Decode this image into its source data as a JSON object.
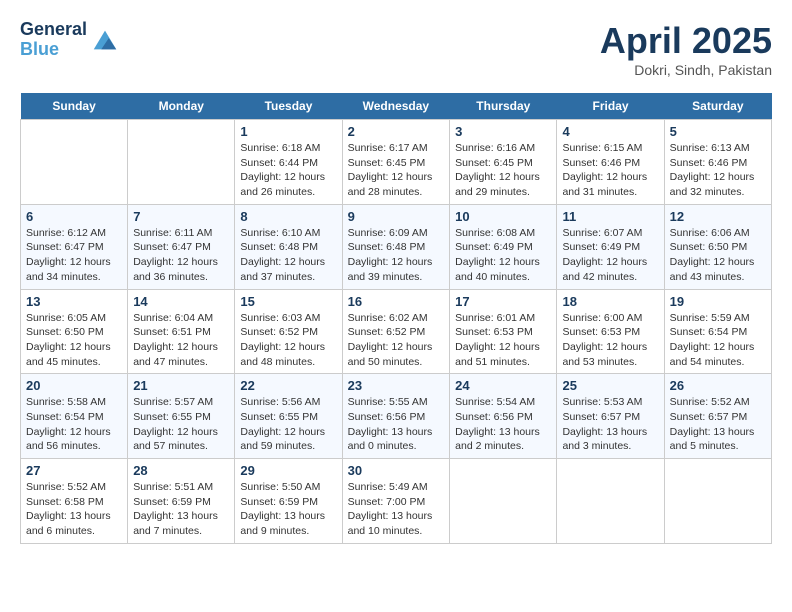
{
  "header": {
    "logo_line1": "General",
    "logo_line2": "Blue",
    "month": "April 2025",
    "location": "Dokri, Sindh, Pakistan"
  },
  "days_of_week": [
    "Sunday",
    "Monday",
    "Tuesday",
    "Wednesday",
    "Thursday",
    "Friday",
    "Saturday"
  ],
  "weeks": [
    [
      {
        "day": "",
        "info": ""
      },
      {
        "day": "",
        "info": ""
      },
      {
        "day": "1",
        "info": "Sunrise: 6:18 AM\nSunset: 6:44 PM\nDaylight: 12 hours\nand 26 minutes."
      },
      {
        "day": "2",
        "info": "Sunrise: 6:17 AM\nSunset: 6:45 PM\nDaylight: 12 hours\nand 28 minutes."
      },
      {
        "day": "3",
        "info": "Sunrise: 6:16 AM\nSunset: 6:45 PM\nDaylight: 12 hours\nand 29 minutes."
      },
      {
        "day": "4",
        "info": "Sunrise: 6:15 AM\nSunset: 6:46 PM\nDaylight: 12 hours\nand 31 minutes."
      },
      {
        "day": "5",
        "info": "Sunrise: 6:13 AM\nSunset: 6:46 PM\nDaylight: 12 hours\nand 32 minutes."
      }
    ],
    [
      {
        "day": "6",
        "info": "Sunrise: 6:12 AM\nSunset: 6:47 PM\nDaylight: 12 hours\nand 34 minutes."
      },
      {
        "day": "7",
        "info": "Sunrise: 6:11 AM\nSunset: 6:47 PM\nDaylight: 12 hours\nand 36 minutes."
      },
      {
        "day": "8",
        "info": "Sunrise: 6:10 AM\nSunset: 6:48 PM\nDaylight: 12 hours\nand 37 minutes."
      },
      {
        "day": "9",
        "info": "Sunrise: 6:09 AM\nSunset: 6:48 PM\nDaylight: 12 hours\nand 39 minutes."
      },
      {
        "day": "10",
        "info": "Sunrise: 6:08 AM\nSunset: 6:49 PM\nDaylight: 12 hours\nand 40 minutes."
      },
      {
        "day": "11",
        "info": "Sunrise: 6:07 AM\nSunset: 6:49 PM\nDaylight: 12 hours\nand 42 minutes."
      },
      {
        "day": "12",
        "info": "Sunrise: 6:06 AM\nSunset: 6:50 PM\nDaylight: 12 hours\nand 43 minutes."
      }
    ],
    [
      {
        "day": "13",
        "info": "Sunrise: 6:05 AM\nSunset: 6:50 PM\nDaylight: 12 hours\nand 45 minutes."
      },
      {
        "day": "14",
        "info": "Sunrise: 6:04 AM\nSunset: 6:51 PM\nDaylight: 12 hours\nand 47 minutes."
      },
      {
        "day": "15",
        "info": "Sunrise: 6:03 AM\nSunset: 6:52 PM\nDaylight: 12 hours\nand 48 minutes."
      },
      {
        "day": "16",
        "info": "Sunrise: 6:02 AM\nSunset: 6:52 PM\nDaylight: 12 hours\nand 50 minutes."
      },
      {
        "day": "17",
        "info": "Sunrise: 6:01 AM\nSunset: 6:53 PM\nDaylight: 12 hours\nand 51 minutes."
      },
      {
        "day": "18",
        "info": "Sunrise: 6:00 AM\nSunset: 6:53 PM\nDaylight: 12 hours\nand 53 minutes."
      },
      {
        "day": "19",
        "info": "Sunrise: 5:59 AM\nSunset: 6:54 PM\nDaylight: 12 hours\nand 54 minutes."
      }
    ],
    [
      {
        "day": "20",
        "info": "Sunrise: 5:58 AM\nSunset: 6:54 PM\nDaylight: 12 hours\nand 56 minutes."
      },
      {
        "day": "21",
        "info": "Sunrise: 5:57 AM\nSunset: 6:55 PM\nDaylight: 12 hours\nand 57 minutes."
      },
      {
        "day": "22",
        "info": "Sunrise: 5:56 AM\nSunset: 6:55 PM\nDaylight: 12 hours\nand 59 minutes."
      },
      {
        "day": "23",
        "info": "Sunrise: 5:55 AM\nSunset: 6:56 PM\nDaylight: 13 hours\nand 0 minutes."
      },
      {
        "day": "24",
        "info": "Sunrise: 5:54 AM\nSunset: 6:56 PM\nDaylight: 13 hours\nand 2 minutes."
      },
      {
        "day": "25",
        "info": "Sunrise: 5:53 AM\nSunset: 6:57 PM\nDaylight: 13 hours\nand 3 minutes."
      },
      {
        "day": "26",
        "info": "Sunrise: 5:52 AM\nSunset: 6:57 PM\nDaylight: 13 hours\nand 5 minutes."
      }
    ],
    [
      {
        "day": "27",
        "info": "Sunrise: 5:52 AM\nSunset: 6:58 PM\nDaylight: 13 hours\nand 6 minutes."
      },
      {
        "day": "28",
        "info": "Sunrise: 5:51 AM\nSunset: 6:59 PM\nDaylight: 13 hours\nand 7 minutes."
      },
      {
        "day": "29",
        "info": "Sunrise: 5:50 AM\nSunset: 6:59 PM\nDaylight: 13 hours\nand 9 minutes."
      },
      {
        "day": "30",
        "info": "Sunrise: 5:49 AM\nSunset: 7:00 PM\nDaylight: 13 hours\nand 10 minutes."
      },
      {
        "day": "",
        "info": ""
      },
      {
        "day": "",
        "info": ""
      },
      {
        "day": "",
        "info": ""
      }
    ]
  ]
}
